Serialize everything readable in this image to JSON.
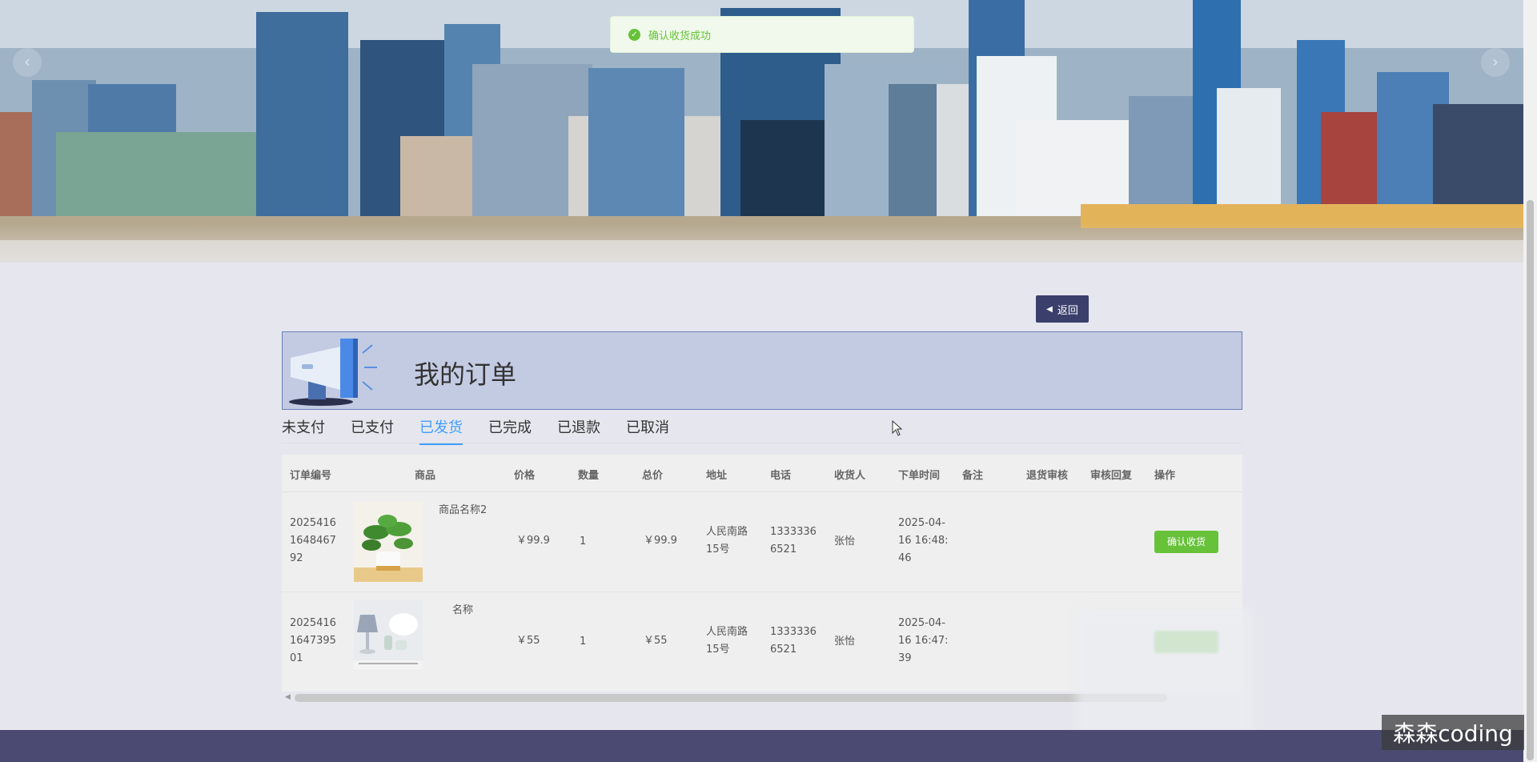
{
  "toast": {
    "message": "确认收货成功"
  },
  "carousel": {
    "prev_icon": "‹",
    "next_icon": "›"
  },
  "back_button": {
    "label": "返回"
  },
  "page": {
    "title": "我的订单"
  },
  "tabs": [
    {
      "label": "未支付",
      "active": false
    },
    {
      "label": "已支付",
      "active": false
    },
    {
      "label": "已发货",
      "active": true
    },
    {
      "label": "已完成",
      "active": false
    },
    {
      "label": "已退款",
      "active": false
    },
    {
      "label": "已取消",
      "active": false
    }
  ],
  "table": {
    "columns": [
      "订单编号",
      "商品",
      "价格",
      "数量",
      "总价",
      "地址",
      "电话",
      "收货人",
      "下单时间",
      "备注",
      "退货审核",
      "审核回复",
      "操作"
    ],
    "rows": [
      {
        "order_no": [
          "2025416",
          "1648467",
          "92"
        ],
        "product_name": "商品名称2",
        "price": "￥99.9",
        "quantity": "1",
        "total": "￥99.9",
        "address": [
          "人民南路",
          "15号"
        ],
        "phone": [
          "1333336",
          "6521"
        ],
        "receiver": "张怡",
        "order_time": [
          "2025-04-",
          "16 16:48:",
          "46"
        ],
        "remark": "",
        "return_review": "",
        "review_reply": "",
        "action": "确认收货"
      },
      {
        "order_no": [
          "2025416",
          "1647395",
          "01"
        ],
        "product_name": "名称",
        "price": "￥55",
        "quantity": "1",
        "total": "￥55",
        "address": [
          "人民南路",
          "15号"
        ],
        "phone": [
          "1333336",
          "6521"
        ],
        "receiver": "张怡",
        "order_time": [
          "2025-04-",
          "16 16:47:",
          "39"
        ],
        "remark": "",
        "return_review": "",
        "review_reply": "",
        "action": ""
      }
    ]
  },
  "watermark": "森森coding",
  "colors": {
    "accent": "#409eff",
    "success": "#67c23a",
    "header_bg": "#c3cbe3",
    "footer_bg": "#4a4a72"
  }
}
